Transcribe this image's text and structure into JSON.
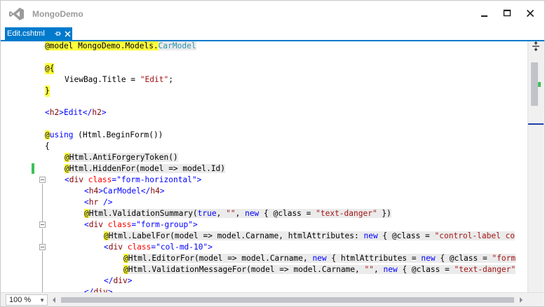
{
  "window": {
    "title": "MongoDemo",
    "minimize_glyph": "—",
    "maximize_glyph": "☐",
    "close_glyph": "✕"
  },
  "tab": {
    "label": "Edit.cshtml",
    "pin_icon": "pin-icon",
    "close_icon": "close-icon"
  },
  "statusbar": {
    "zoom": "100 %"
  },
  "colors": {
    "accent": "#007acc",
    "keyword": "#0000ff",
    "string": "#a31515",
    "tag": "#800000",
    "attribute": "#ff0000",
    "type": "#2b91af",
    "razor_highlight": "#ffff3e",
    "change_marker": "#3fbf59"
  },
  "code": {
    "l1_a": "@model",
    "l1_b": " MongoDemo.Models.",
    "l1_c": "CarModel",
    "l2_a": "@{",
    "l3_a": "ViewBag.Title = ",
    "l3_b": "\"Edit\"",
    "l3_c": ";",
    "l4_a": "}",
    "l5_a": "<",
    "l5_b": "h2",
    "l5_c": ">Edit</",
    "l5_d": "h2",
    "l5_e": ">",
    "l6_a": "@",
    "l6_b": "using",
    "l6_c": " (Html.BeginForm())",
    "l7_a": "{",
    "l8_a": "@",
    "l8_b": "Html.AntiForgeryToken()",
    "l9_a": "@",
    "l9_b": "Html.HiddenFor(model => model.Id)",
    "l10_a": "<",
    "l10_b": "div",
    "l10_c": " class",
    "l10_d": "=",
    "l10_e": "\"form-horizontal\"",
    "l10_f": ">",
    "l11_a": "<",
    "l11_b": "h4",
    "l11_c": ">CarModel</",
    "l11_d": "h4",
    "l11_e": ">",
    "l12_a": "<",
    "l12_b": "hr",
    "l12_c": " />",
    "l13_a": "@",
    "l13_b": "Html.ValidationSummary(",
    "l13_c": "true",
    "l13_d": ", ",
    "l13_e": "\"\"",
    "l13_f": ", ",
    "l13_g": "new",
    "l13_h": " { @class = ",
    "l13_i": "\"text-danger\"",
    "l13_j": " })",
    "l14_a": "<",
    "l14_b": "div",
    "l14_c": " class",
    "l14_d": "=",
    "l14_e": "\"form-group\"",
    "l14_f": ">",
    "l15_a": "@",
    "l15_b": "Html.LabelFor(model => model.Carname, htmlAttributes: ",
    "l15_c": "new",
    "l15_d": " { @class = ",
    "l15_e": "\"control-label co",
    "l16_a": "<",
    "l16_b": "div",
    "l16_c": " class",
    "l16_d": "=",
    "l16_e": "\"col-md-10\"",
    "l16_f": ">",
    "l17_a": "@",
    "l17_b": "Html.EditorFor(model => model.Carname, ",
    "l17_c": "new",
    "l17_d": " { htmlAttributes = ",
    "l17_e": "new",
    "l17_f": " { @class = ",
    "l17_g": "\"form",
    "l18_a": "@",
    "l18_b": "Html.ValidationMessageFor(model => model.Carname, ",
    "l18_c": "\"\"",
    "l18_d": ", ",
    "l18_e": "new",
    "l18_f": " { @class = ",
    "l18_g": "\"text-danger\"",
    "l19_a": "</",
    "l19_b": "div",
    "l19_c": ">",
    "l20_a": "</",
    "l20_b": "div",
    "l20_c": ">"
  }
}
